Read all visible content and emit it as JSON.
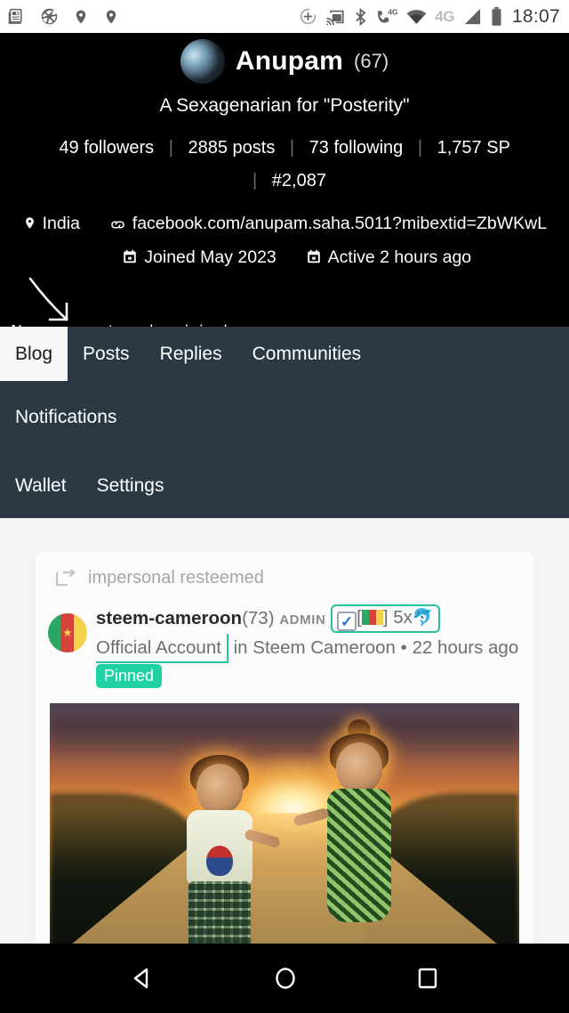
{
  "statusbar": {
    "left_icons": [
      "news-icon",
      "camera-aperture-icon",
      "location-pin-icon",
      "location-pin-icon-2"
    ],
    "right_icons": [
      "add-circle-icon",
      "cast-icon",
      "bluetooth-icon",
      "volte-4g-icon",
      "wifi-icon"
    ],
    "network_label": "4G",
    "signal_icon": "signal-bars-icon",
    "battery_icon": "battery-icon",
    "clock": "18:07"
  },
  "profile": {
    "avatar": "user-avatar-photo",
    "username": "Anupam",
    "reputation": "(67)",
    "tagline": "A Sexagenarian for \"Posterity\"",
    "stats": {
      "followers": "49 followers",
      "posts": "2885 posts",
      "following": "73 following",
      "sp": "1,757 SP",
      "rank": "#2,087"
    },
    "meta": {
      "location_icon": "location-pin-icon",
      "location": "India",
      "link_icon": "link-icon",
      "link": "facebook.com/anupam.saha.5011?mibextid=ZbWKwL",
      "joined_icon": "calendar-icon",
      "joined": "Joined May 2023",
      "active_icon": "calendar-icon",
      "active": "Active 2 hours ago"
    },
    "annotation": {
      "arrow": "handdrawn-arrow-icon",
      "text": "No copy paste only original"
    }
  },
  "nav": {
    "row1": [
      {
        "label": "Blog",
        "active": true
      },
      {
        "label": "Posts",
        "active": false
      },
      {
        "label": "Replies",
        "active": false
      },
      {
        "label": "Communities",
        "active": false
      }
    ],
    "row2": [
      {
        "label": "Notifications",
        "active": false
      }
    ],
    "row3": [
      {
        "label": "Wallet",
        "active": false
      },
      {
        "label": "Settings",
        "active": false
      }
    ]
  },
  "post": {
    "resteem_icon": "resteem-arrow-icon",
    "resteem_text": "impersonal resteemed",
    "avatar": "cameroon-flag-avatar",
    "author": "steem-cameroon",
    "author_reputation": "(73)",
    "role": "ADMIN",
    "badge": {
      "check_icon": "white-check-mark-icon",
      "bracket_open": "[",
      "flag_icon": "cameroon-flag-icon",
      "bracket_close": "]",
      "multiplier": "5x",
      "dolphin_icon": "dolphin-icon"
    },
    "official_account": "Official Account",
    "community_prefix": "in",
    "community": "Steem Cameroon",
    "dot": "•",
    "time": "22 hours ago",
    "pinned": "Pinned",
    "image": "two-children-holding-hands-at-sunset"
  },
  "androidnav": {
    "back": "back-triangle-icon",
    "home": "home-circle-icon",
    "recents": "recents-square-icon"
  },
  "colors": {
    "nav_bg": "#2c3944",
    "page_bg": "#f4f4f4",
    "accent_teal": "#29c0a0",
    "pinned_bg": "#1fd1a5",
    "profile_bg": "#000000"
  }
}
